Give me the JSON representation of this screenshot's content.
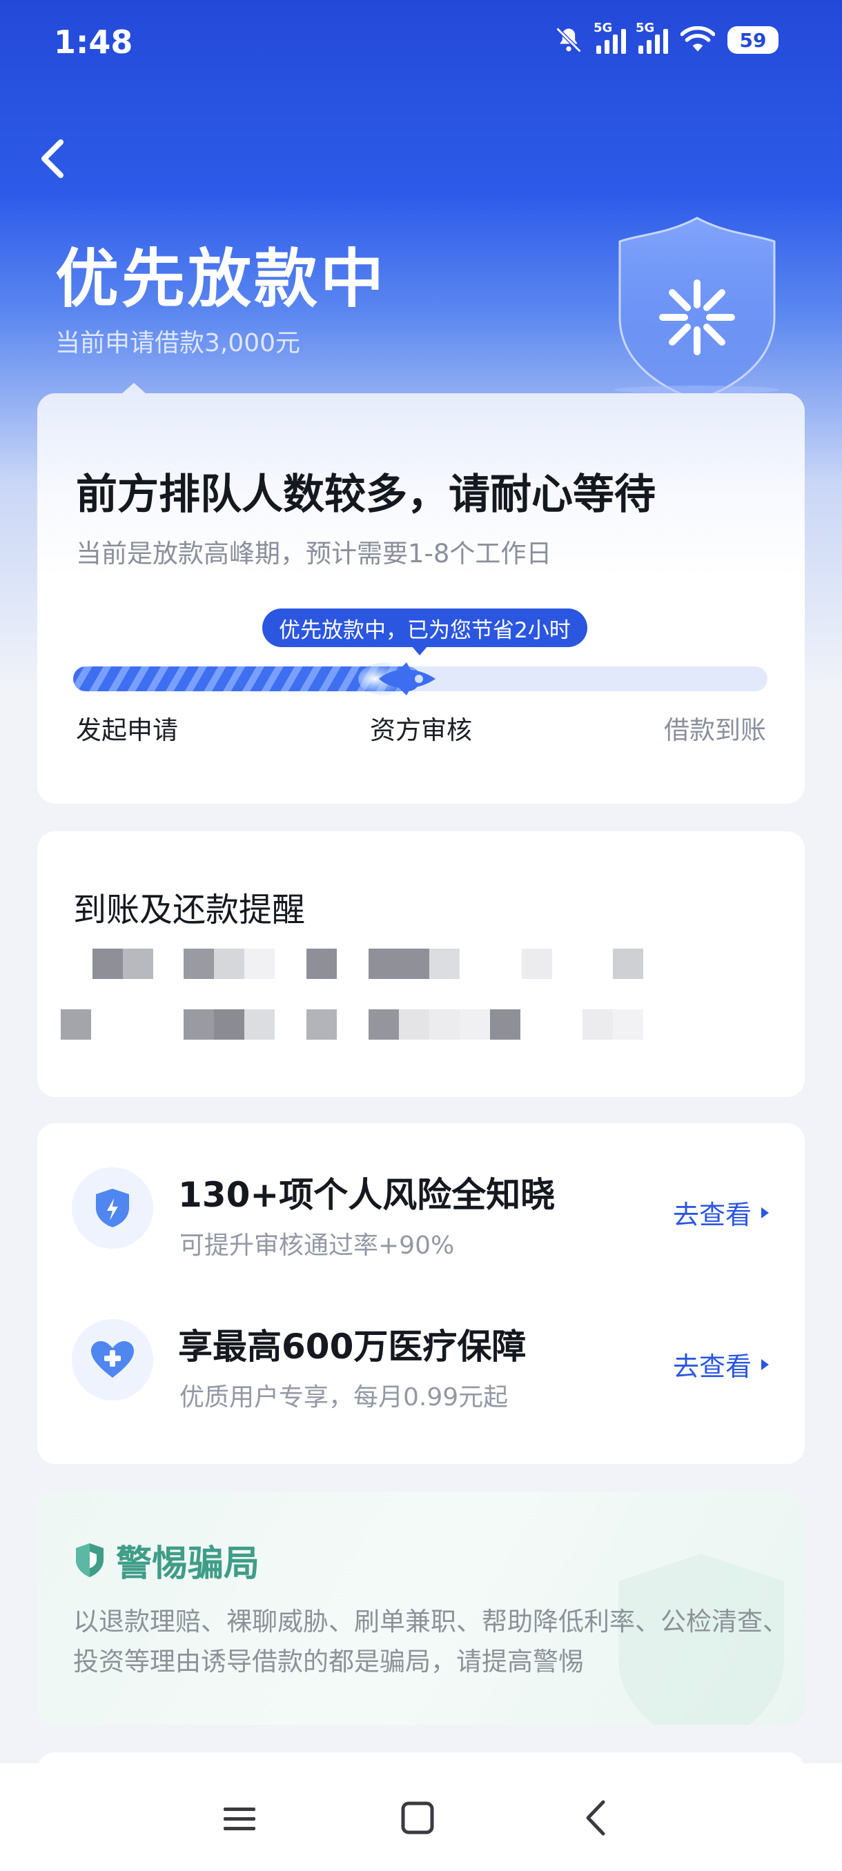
{
  "status_bar": {
    "time": "1:48",
    "network_1": "5G",
    "network_2": "5G",
    "battery": "59",
    "icons": [
      "bell-muted-icon",
      "signal-icon",
      "signal-icon",
      "wifi-icon",
      "battery-icon"
    ]
  },
  "header": {
    "title": "优先放款中",
    "subtitle": "当前申请借款3,000元"
  },
  "progress_card": {
    "title": "前方排队人数较多，请耐心等待",
    "description": "当前是放款高峰期，预计需要1-8个工作日",
    "pill": "优先放款中，已为您节省2小时",
    "progress": 0.5,
    "steps": [
      "发起申请",
      "资方审核",
      "借款到账"
    ],
    "active_step": 1
  },
  "reminder_card": {
    "title": "到账及还款提醒"
  },
  "services": [
    {
      "title": "130+项个人风险全知晓",
      "subtitle": "可提升审核通过率+90%",
      "link": "去查看",
      "icon": "shield-bolt-icon"
    },
    {
      "title": "享最高600万医疗保障",
      "subtitle": "优质用户专享，每月0.99元起",
      "link": "去查看",
      "icon": "heart-plus-icon"
    }
  ],
  "fraud_card": {
    "title": "警惕骗局",
    "text": "以退款理赔、裸聊威胁、刷单兼职、帮助降低利率、公检清查、投资等理由诱导借款的都是骗局，请提高警惕"
  },
  "colors": {
    "brand": "#2b56e0",
    "hero_top": "#2449d8",
    "fraud_accent": "#3f9d88"
  }
}
